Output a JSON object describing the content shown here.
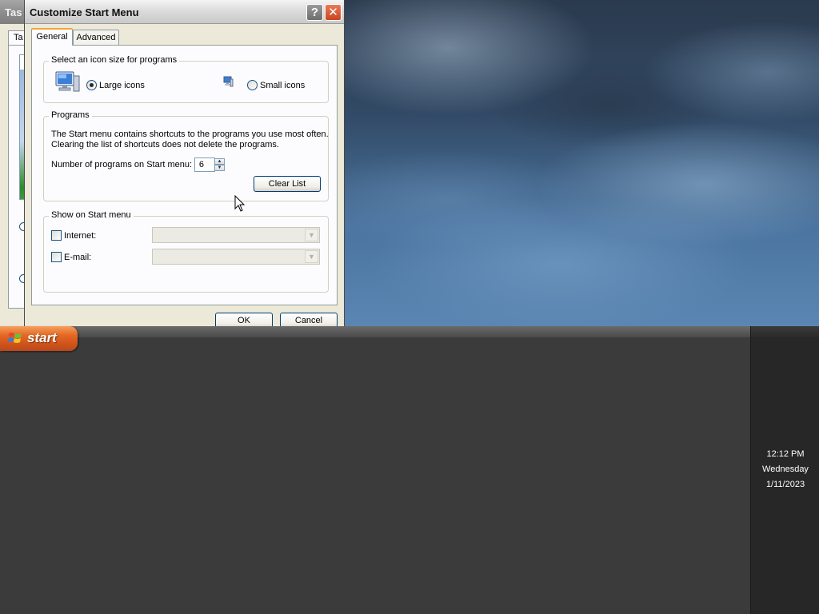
{
  "background_window": {
    "title": "Tas",
    "tab_label": "Ta"
  },
  "dialog": {
    "title": "Customize Start Menu",
    "help_button": "?",
    "close_button": "✕",
    "tabs": [
      {
        "label": "General",
        "active": true
      },
      {
        "label": "Advanced",
        "active": false
      }
    ],
    "icon_size_group": {
      "label": "Select an icon size for programs",
      "options": [
        {
          "label": "Large icons",
          "checked": true,
          "icon": "large-computer-icon"
        },
        {
          "label": "Small icons",
          "checked": false,
          "icon": "small-computer-icon"
        }
      ]
    },
    "programs_group": {
      "label": "Programs",
      "description_line1": "The Start menu contains shortcuts to the programs you use most often.",
      "description_line2": "Clearing the list of shortcuts does not delete the programs.",
      "count_label": "Number of programs on Start menu:",
      "count_value": "6",
      "clear_button": "Clear List"
    },
    "show_group": {
      "label": "Show on Start menu",
      "items": [
        {
          "label": "Internet:",
          "checked": false,
          "value": ""
        },
        {
          "label": "E-mail:",
          "checked": false,
          "value": ""
        }
      ]
    },
    "ok_button": "OK",
    "cancel_button": "Cancel"
  },
  "taskbar": {
    "start_label": "start",
    "clock": {
      "time": "12:12 PM",
      "day": "Wednesday",
      "date": "1/11/2023"
    }
  }
}
